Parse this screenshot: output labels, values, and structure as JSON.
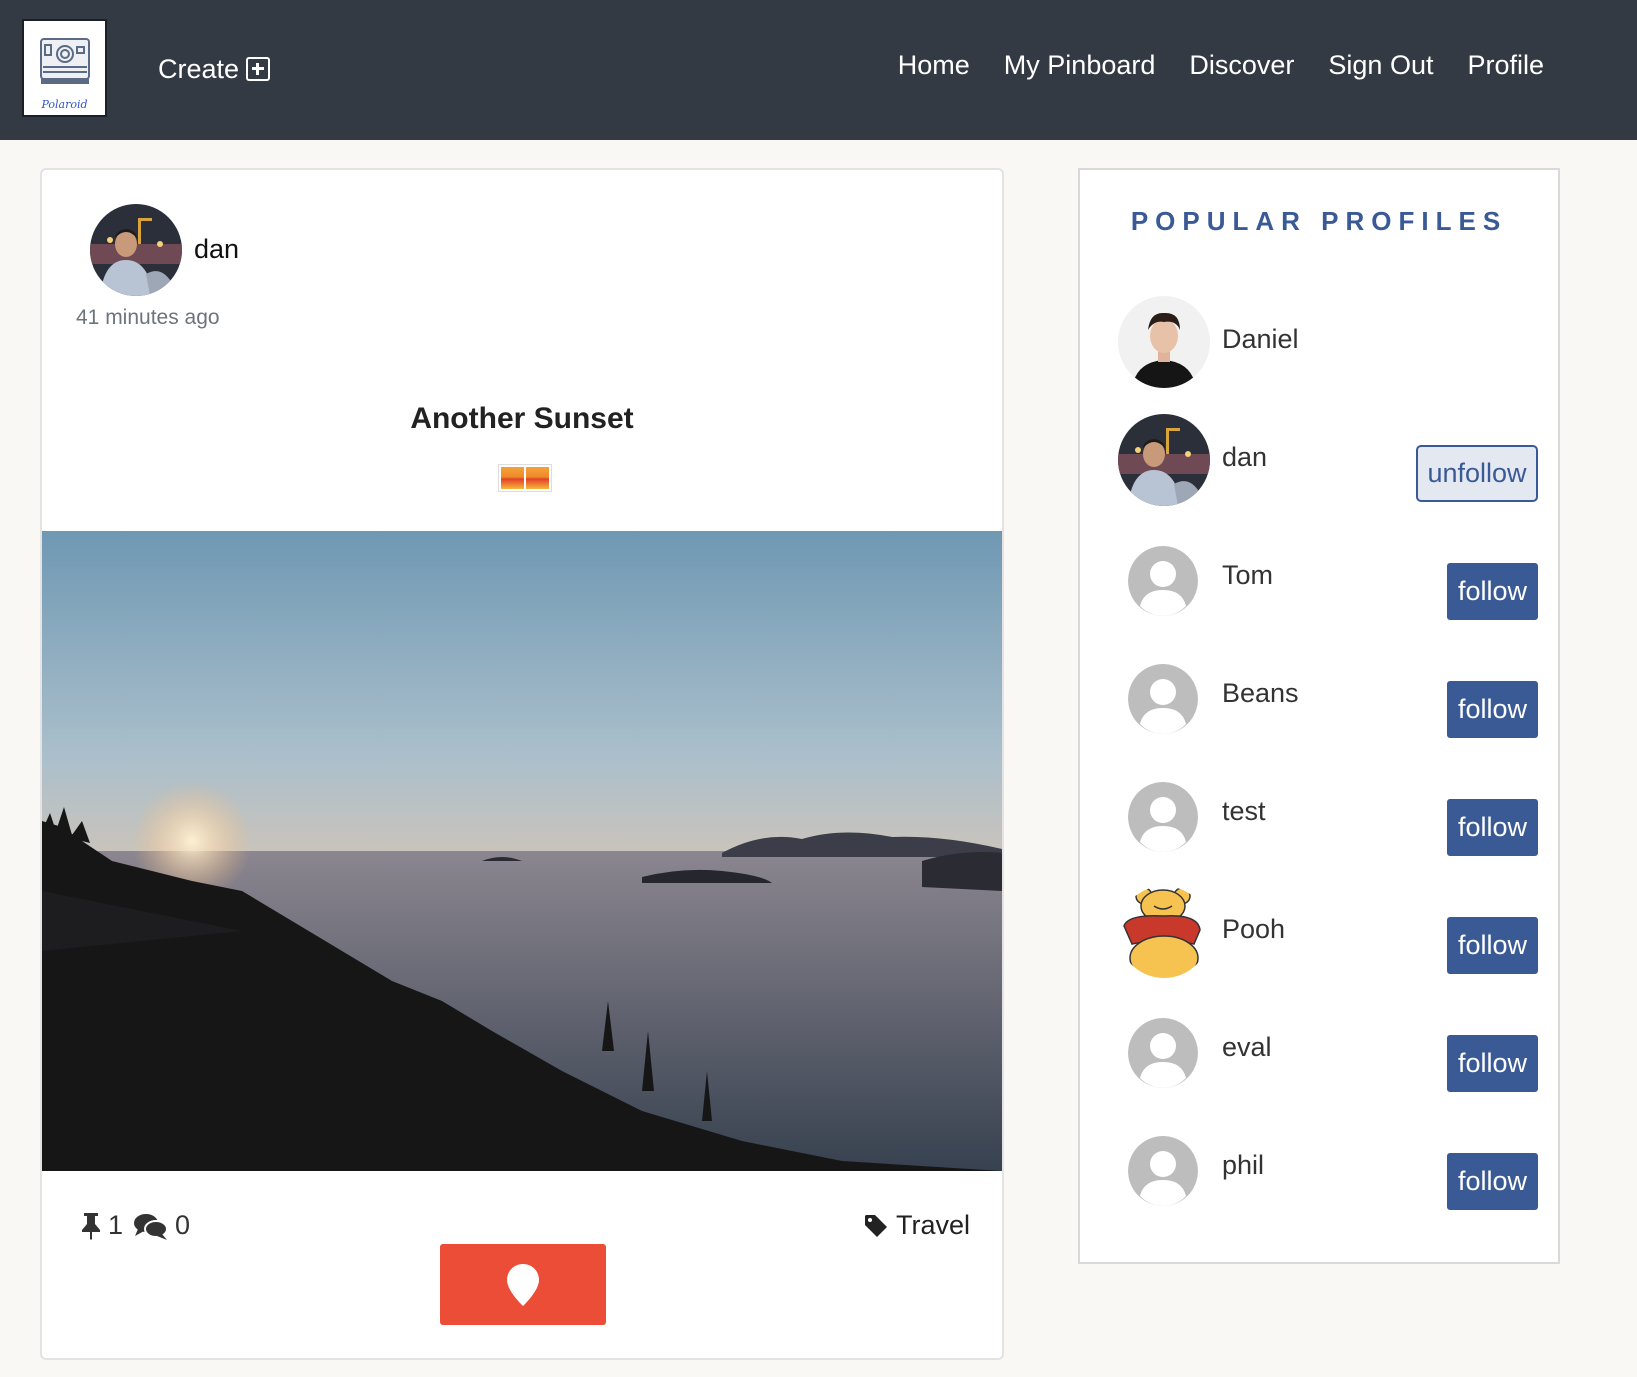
{
  "colors": {
    "navbar_bg": "#343a43",
    "accent_blue": "#3a5a95",
    "pin_red": "#eb4d36",
    "page_bg": "#f9f8f5"
  },
  "nav": {
    "logo_text": "Polaroid",
    "create_label": "Create",
    "links": [
      "Home",
      "My Pinboard",
      "Discover",
      "Sign Out",
      "Profile"
    ]
  },
  "post": {
    "username": "dan",
    "time": "41 minutes ago",
    "title": "Another Sunset",
    "pins": "1",
    "comments": "0",
    "tag": "Travel"
  },
  "profiles": {
    "title": "POPULAR PROFILES",
    "items": [
      {
        "name": "Daniel",
        "avatar": "photo-daniel",
        "button": ""
      },
      {
        "name": "dan",
        "avatar": "photo-dan",
        "button": "unfollow"
      },
      {
        "name": "Tom",
        "avatar": "default-avatar",
        "button": "follow"
      },
      {
        "name": "Beans",
        "avatar": "default-avatar",
        "button": "follow"
      },
      {
        "name": "test",
        "avatar": "default-avatar",
        "button": "follow"
      },
      {
        "name": "Pooh",
        "avatar": "photo-pooh",
        "button": "follow"
      },
      {
        "name": "eval",
        "avatar": "default-avatar",
        "button": "follow"
      },
      {
        "name": "phil",
        "avatar": "default-avatar",
        "button": "follow"
      }
    ]
  }
}
